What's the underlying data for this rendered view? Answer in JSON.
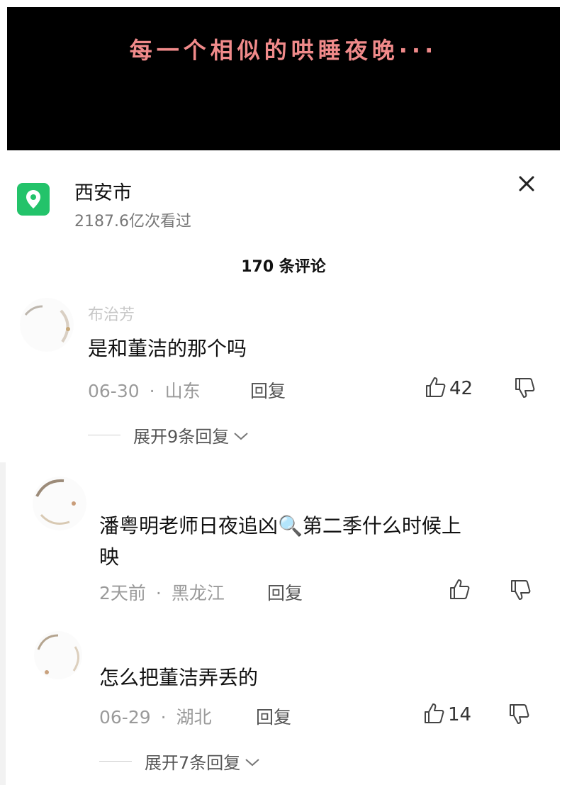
{
  "video": {
    "caption": "每一个相似的哄睡夜晚···"
  },
  "location": {
    "title": "西安市",
    "views": "2187.6亿次看过",
    "icon": "map-pin-icon",
    "accent": "#23c36a"
  },
  "comments_header": {
    "count_label": "170 条评论"
  },
  "comments": [
    {
      "username": "布治芳",
      "text": "是和董洁的那个吗",
      "date": "06-30",
      "region": "山东",
      "reply_label": "回复",
      "likes": "42",
      "expand_label": "展开9条回复"
    },
    {
      "username": "",
      "text_line1": "潘粤明老师日夜追凶🔍第二季什么时候上",
      "text_line2": "映",
      "date": "2天前",
      "region": "黑龙江",
      "reply_label": "回复",
      "likes": ""
    },
    {
      "username": "",
      "text": "怎么把董洁弄丢的",
      "date": "06-29",
      "region": "湖北",
      "reply_label": "回复",
      "likes": "14",
      "expand_label": "展开7条回复"
    }
  ]
}
